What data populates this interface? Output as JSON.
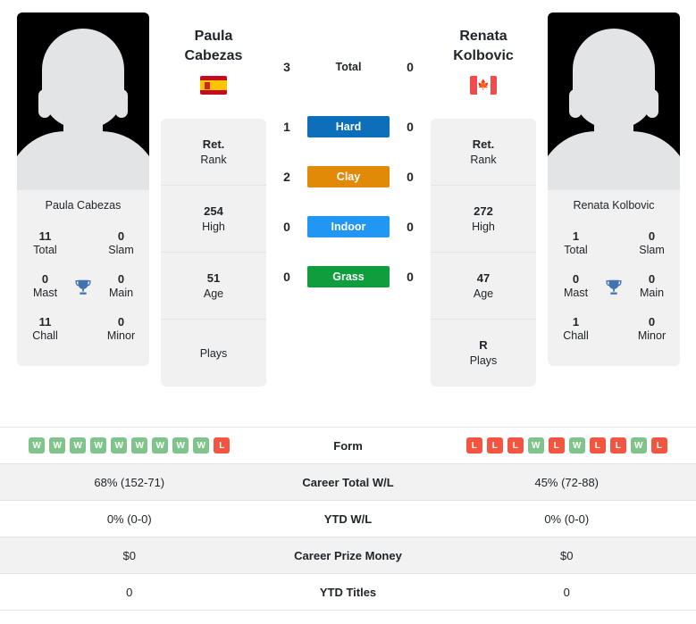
{
  "left_player": {
    "photo_caption": "Paula Cabezas",
    "display_name_line1": "Paula",
    "display_name_line2": "Cabezas",
    "flag": "spain-flag",
    "titles": {
      "total_value": "11",
      "total_label": "Total",
      "slam_value": "0",
      "slam_label": "Slam",
      "mast_value": "0",
      "mast_label": "Mast",
      "main_value": "0",
      "main_label": "Main",
      "chall_value": "11",
      "chall_label": "Chall",
      "minor_value": "0",
      "minor_label": "Minor",
      "trophy_icon": "trophy-icon"
    },
    "stats": [
      {
        "value": "Ret.",
        "label": "Rank"
      },
      {
        "value": "254",
        "label": "High"
      },
      {
        "value": "51",
        "label": "Age"
      },
      {
        "value": "",
        "label": "Plays"
      }
    ],
    "form": [
      "W",
      "W",
      "W",
      "W",
      "W",
      "W",
      "W",
      "W",
      "W",
      "L"
    ],
    "career_total_wl": "68% (152-71)",
    "ytd_wl": "0% (0-0)",
    "career_prize_money": "$0",
    "ytd_titles": "0"
  },
  "right_player": {
    "photo_caption": "Renata Kolbovic",
    "display_name_line1": "Renata",
    "display_name_line2": "Kolbovic",
    "flag": "canada-flag",
    "titles": {
      "total_value": "1",
      "total_label": "Total",
      "slam_value": "0",
      "slam_label": "Slam",
      "mast_value": "0",
      "mast_label": "Mast",
      "main_value": "0",
      "main_label": "Main",
      "chall_value": "1",
      "chall_label": "Chall",
      "minor_value": "0",
      "minor_label": "Minor",
      "trophy_icon": "trophy-icon"
    },
    "stats": [
      {
        "value": "Ret.",
        "label": "Rank"
      },
      {
        "value": "272",
        "label": "High"
      },
      {
        "value": "47",
        "label": "Age"
      },
      {
        "value": "R",
        "label": "Plays"
      }
    ],
    "form": [
      "L",
      "L",
      "L",
      "W",
      "L",
      "W",
      "L",
      "L",
      "W",
      "L"
    ],
    "career_total_wl": "45% (72-88)",
    "ytd_wl": "0% (0-0)",
    "career_prize_money": "$0",
    "ytd_titles": "0"
  },
  "head_to_head": {
    "total": {
      "label": "Total",
      "left": "3",
      "right": "0"
    },
    "surfaces": [
      {
        "label": "Hard",
        "left": "1",
        "right": "0",
        "color": "#0d6fba"
      },
      {
        "label": "Clay",
        "left": "2",
        "right": "0",
        "color": "#e18a07"
      },
      {
        "label": "Indoor",
        "left": "0",
        "right": "0",
        "color": "#2196f3"
      },
      {
        "label": "Grass",
        "left": "0",
        "right": "0",
        "color": "#0f9d3d"
      }
    ]
  },
  "stats_table": {
    "form_label": "Form",
    "rows": [
      {
        "label": "Career Total W/L",
        "left": "68% (152-71)",
        "right": "45% (72-88)"
      },
      {
        "label": "YTD W/L",
        "left": "0% (0-0)",
        "right": "0% (0-0)"
      },
      {
        "label": "Career Prize Money",
        "left": "$0",
        "right": "$0"
      },
      {
        "label": "YTD Titles",
        "left": "0",
        "right": "0"
      }
    ]
  },
  "colors": {
    "win_badge": "#7fc48b",
    "loss_badge": "#f35541",
    "trophy": "#4273b0",
    "panel_bg": "#f1f1f1",
    "row_shaded": "#f2f2f2"
  }
}
